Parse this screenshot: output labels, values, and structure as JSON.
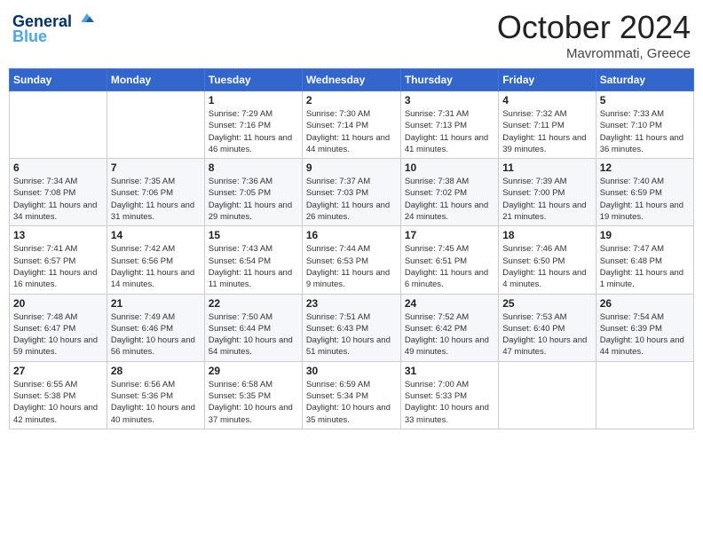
{
  "header": {
    "logo_line1": "General",
    "logo_line2": "Blue",
    "month": "October 2024",
    "location": "Mavrommati, Greece"
  },
  "days_of_week": [
    "Sunday",
    "Monday",
    "Tuesday",
    "Wednesday",
    "Thursday",
    "Friday",
    "Saturday"
  ],
  "weeks": [
    [
      {
        "day": "",
        "info": ""
      },
      {
        "day": "",
        "info": ""
      },
      {
        "day": "1",
        "info": "Sunrise: 7:29 AM\nSunset: 7:16 PM\nDaylight: 11 hours and 46 minutes."
      },
      {
        "day": "2",
        "info": "Sunrise: 7:30 AM\nSunset: 7:14 PM\nDaylight: 11 hours and 44 minutes."
      },
      {
        "day": "3",
        "info": "Sunrise: 7:31 AM\nSunset: 7:13 PM\nDaylight: 11 hours and 41 minutes."
      },
      {
        "day": "4",
        "info": "Sunrise: 7:32 AM\nSunset: 7:11 PM\nDaylight: 11 hours and 39 minutes."
      },
      {
        "day": "5",
        "info": "Sunrise: 7:33 AM\nSunset: 7:10 PM\nDaylight: 11 hours and 36 minutes."
      }
    ],
    [
      {
        "day": "6",
        "info": "Sunrise: 7:34 AM\nSunset: 7:08 PM\nDaylight: 11 hours and 34 minutes."
      },
      {
        "day": "7",
        "info": "Sunrise: 7:35 AM\nSunset: 7:06 PM\nDaylight: 11 hours and 31 minutes."
      },
      {
        "day": "8",
        "info": "Sunrise: 7:36 AM\nSunset: 7:05 PM\nDaylight: 11 hours and 29 minutes."
      },
      {
        "day": "9",
        "info": "Sunrise: 7:37 AM\nSunset: 7:03 PM\nDaylight: 11 hours and 26 minutes."
      },
      {
        "day": "10",
        "info": "Sunrise: 7:38 AM\nSunset: 7:02 PM\nDaylight: 11 hours and 24 minutes."
      },
      {
        "day": "11",
        "info": "Sunrise: 7:39 AM\nSunset: 7:00 PM\nDaylight: 11 hours and 21 minutes."
      },
      {
        "day": "12",
        "info": "Sunrise: 7:40 AM\nSunset: 6:59 PM\nDaylight: 11 hours and 19 minutes."
      }
    ],
    [
      {
        "day": "13",
        "info": "Sunrise: 7:41 AM\nSunset: 6:57 PM\nDaylight: 11 hours and 16 minutes."
      },
      {
        "day": "14",
        "info": "Sunrise: 7:42 AM\nSunset: 6:56 PM\nDaylight: 11 hours and 14 minutes."
      },
      {
        "day": "15",
        "info": "Sunrise: 7:43 AM\nSunset: 6:54 PM\nDaylight: 11 hours and 11 minutes."
      },
      {
        "day": "16",
        "info": "Sunrise: 7:44 AM\nSunset: 6:53 PM\nDaylight: 11 hours and 9 minutes."
      },
      {
        "day": "17",
        "info": "Sunrise: 7:45 AM\nSunset: 6:51 PM\nDaylight: 11 hours and 6 minutes."
      },
      {
        "day": "18",
        "info": "Sunrise: 7:46 AM\nSunset: 6:50 PM\nDaylight: 11 hours and 4 minutes."
      },
      {
        "day": "19",
        "info": "Sunrise: 7:47 AM\nSunset: 6:48 PM\nDaylight: 11 hours and 1 minute."
      }
    ],
    [
      {
        "day": "20",
        "info": "Sunrise: 7:48 AM\nSunset: 6:47 PM\nDaylight: 10 hours and 59 minutes."
      },
      {
        "day": "21",
        "info": "Sunrise: 7:49 AM\nSunset: 6:46 PM\nDaylight: 10 hours and 56 minutes."
      },
      {
        "day": "22",
        "info": "Sunrise: 7:50 AM\nSunset: 6:44 PM\nDaylight: 10 hours and 54 minutes."
      },
      {
        "day": "23",
        "info": "Sunrise: 7:51 AM\nSunset: 6:43 PM\nDaylight: 10 hours and 51 minutes."
      },
      {
        "day": "24",
        "info": "Sunrise: 7:52 AM\nSunset: 6:42 PM\nDaylight: 10 hours and 49 minutes."
      },
      {
        "day": "25",
        "info": "Sunrise: 7:53 AM\nSunset: 6:40 PM\nDaylight: 10 hours and 47 minutes."
      },
      {
        "day": "26",
        "info": "Sunrise: 7:54 AM\nSunset: 6:39 PM\nDaylight: 10 hours and 44 minutes."
      }
    ],
    [
      {
        "day": "27",
        "info": "Sunrise: 6:55 AM\nSunset: 5:38 PM\nDaylight: 10 hours and 42 minutes."
      },
      {
        "day": "28",
        "info": "Sunrise: 6:56 AM\nSunset: 5:36 PM\nDaylight: 10 hours and 40 minutes."
      },
      {
        "day": "29",
        "info": "Sunrise: 6:58 AM\nSunset: 5:35 PM\nDaylight: 10 hours and 37 minutes."
      },
      {
        "day": "30",
        "info": "Sunrise: 6:59 AM\nSunset: 5:34 PM\nDaylight: 10 hours and 35 minutes."
      },
      {
        "day": "31",
        "info": "Sunrise: 7:00 AM\nSunset: 5:33 PM\nDaylight: 10 hours and 33 minutes."
      },
      {
        "day": "",
        "info": ""
      },
      {
        "day": "",
        "info": ""
      }
    ]
  ]
}
